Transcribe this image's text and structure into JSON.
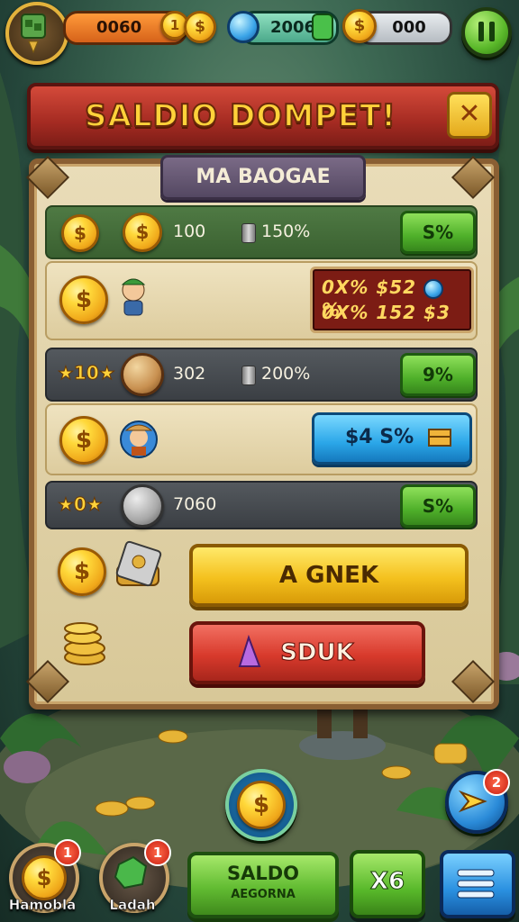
{
  "hud": {
    "bar1_value": "0060",
    "bar1_badge": "1",
    "bar2_value": "2006",
    "bar3_value": "000"
  },
  "banner": {
    "title": "SALDIO DOMPET!",
    "close_glyph": "✕"
  },
  "panel": {
    "subtitle": "MA BAOGAE",
    "row1": {
      "amount": "100",
      "rate": "150%",
      "button": "S%"
    },
    "row2": {
      "price_line1": "0X% $52",
      "price_line1_suffix": "%",
      "price_line2": "0X% 152  $3"
    },
    "row3": {
      "stars": "★10★",
      "amount": "302",
      "rate": "200%",
      "button": "9%"
    },
    "row4": {
      "button_text": "$4  S%"
    },
    "row5": {
      "stars": "★0★",
      "amount": "7060",
      "button": "S%"
    },
    "primary_button": "A GNEK",
    "secondary_button": "SDUK"
  },
  "bottom_nav": {
    "item1_label": "Hamobla",
    "item1_badge": "1",
    "item2_label": "Ladah",
    "item2_badge": "1",
    "saldo_title": "SALDO",
    "saldo_sub": "AEGORNA",
    "x_button": "X6",
    "arrow_badge": "2"
  },
  "colors": {
    "accent_yellow": "#f4c11e",
    "banner_red": "#a52b22",
    "action_green": "#4fb02a",
    "info_blue": "#2aa6e8"
  },
  "icons": [
    "settings-avatar-icon",
    "coin-icon",
    "gem-icon",
    "pause-icon",
    "close-icon",
    "character-icon",
    "chest-icon",
    "cash-stack-icon",
    "coin-stack-icon",
    "potion-icon",
    "arrow-icon",
    "menu-icon"
  ]
}
